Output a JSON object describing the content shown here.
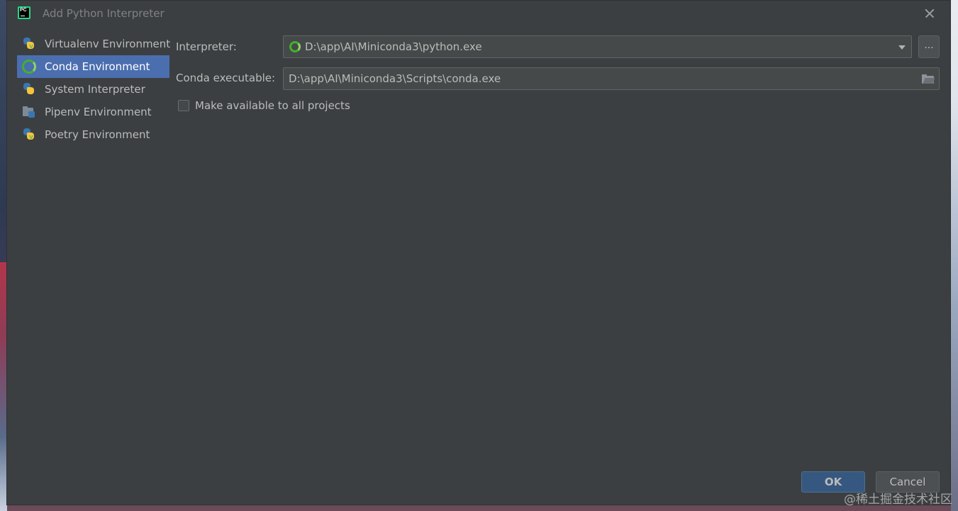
{
  "window": {
    "title": "Add Python Interpreter"
  },
  "sidebar": {
    "items": [
      {
        "label": "Virtualenv Environment",
        "icon": "python-virtualenv-icon"
      },
      {
        "label": "Conda Environment",
        "icon": "conda-icon",
        "selected": true
      },
      {
        "label": "System Interpreter",
        "icon": "python-icon"
      },
      {
        "label": "Pipenv Environment",
        "icon": "pipenv-icon"
      },
      {
        "label": "Poetry Environment",
        "icon": "poetry-icon"
      }
    ]
  },
  "form": {
    "interpreter_label": "Interpreter:",
    "interpreter_value": "D:\\app\\AI\\Miniconda3\\python.exe",
    "browse_button": "...",
    "conda_label": "Conda executable:",
    "conda_value": "D:\\app\\AI\\Miniconda3\\Scripts\\conda.exe",
    "available_label": "Make available to all projects",
    "available_checked": false
  },
  "buttons": {
    "ok": "OK",
    "cancel": "Cancel"
  },
  "watermark": "@稀土掘金技术社区",
  "colors": {
    "selection": "#4b6eaf",
    "dialog_bg": "#3c3f41",
    "ok_button": "#365880"
  }
}
